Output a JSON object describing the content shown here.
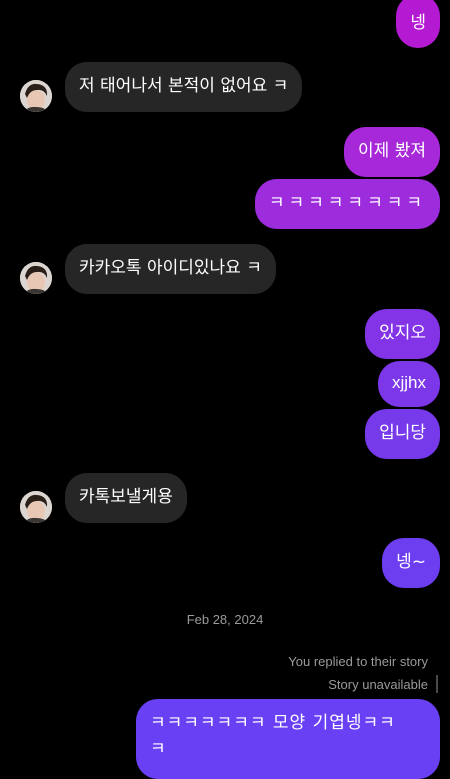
{
  "colors": {
    "background": "#000000",
    "incoming_bubble": "#262626",
    "outgoing_gradient_top": "#b41ad2",
    "outgoing_gradient_bottom": "#6a40f4",
    "meta_text": "#9a9a9a"
  },
  "messages": [
    {
      "id": "m1",
      "direction": "outgoing",
      "text": "넹"
    },
    {
      "id": "m2",
      "direction": "incoming",
      "text": "저 태어나서 본적이 없어요 ㅋ",
      "avatar": "user-avatar"
    },
    {
      "id": "m3",
      "direction": "outgoing",
      "text": "이제 봤져"
    },
    {
      "id": "m4",
      "direction": "outgoing",
      "text": "ㅋㅋㅋㅋㅋㅋㅋㅋ"
    },
    {
      "id": "m5",
      "direction": "incoming",
      "text": "카카오톡 아이디있나요 ㅋ",
      "avatar": "user-avatar"
    },
    {
      "id": "m6",
      "direction": "outgoing",
      "text": "있지오"
    },
    {
      "id": "m7",
      "direction": "outgoing",
      "text": "xjjhx"
    },
    {
      "id": "m8",
      "direction": "outgoing",
      "text": "입니당"
    },
    {
      "id": "m9",
      "direction": "incoming",
      "text": "카톡보낼게용",
      "avatar": "user-avatar"
    },
    {
      "id": "m10",
      "direction": "outgoing",
      "text": "넹~"
    }
  ],
  "date_separator": "Feb 28, 2024",
  "story_reply": {
    "note": "You replied to their story",
    "status": "Story unavailable"
  },
  "last_message": {
    "line1": "ㅋㅋㅋㅋㅋㅋㅋ 모양 기엽넹ㅋㅋ",
    "line2": "ㅋ"
  }
}
